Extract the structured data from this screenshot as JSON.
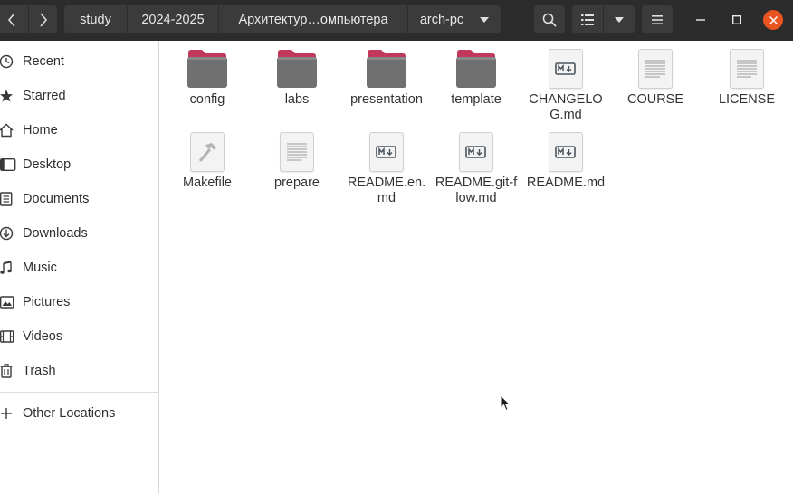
{
  "header": {
    "breadcrumbs": [
      "study",
      "2024-2025",
      "Архитектур…омпьютера",
      "arch-pc"
    ],
    "icons": {
      "back": "chevron-left-icon",
      "forward": "chevron-right-icon",
      "search": "search-icon",
      "view": "list-view-icon",
      "view_menu": "chevron-down-icon",
      "menu": "hamburger-menu-icon",
      "minimize": "minimize-icon",
      "maximize": "maximize-icon",
      "close": "close-icon"
    },
    "close_color": "#e95420"
  },
  "sidebar": {
    "items": [
      {
        "label": "Recent",
        "icon": "clock-icon"
      },
      {
        "label": "Starred",
        "icon": "star-icon"
      },
      {
        "label": "Home",
        "icon": "home-icon"
      },
      {
        "label": "Desktop",
        "icon": "desktop-icon"
      },
      {
        "label": "Documents",
        "icon": "documents-icon"
      },
      {
        "label": "Downloads",
        "icon": "download-icon"
      },
      {
        "label": "Music",
        "icon": "music-icon"
      },
      {
        "label": "Pictures",
        "icon": "pictures-icon"
      },
      {
        "label": "Videos",
        "icon": "videos-icon"
      },
      {
        "label": "Trash",
        "icon": "trash-icon"
      }
    ],
    "other_locations": {
      "label": "Other Locations",
      "icon": "plus-icon"
    }
  },
  "files": [
    {
      "name": "config",
      "type": "folder"
    },
    {
      "name": "labs",
      "type": "folder"
    },
    {
      "name": "presentation",
      "type": "folder"
    },
    {
      "name": "template",
      "type": "folder"
    },
    {
      "name": "CHANGELOG.md",
      "type": "markdown"
    },
    {
      "name": "COURSE",
      "type": "text"
    },
    {
      "name": "LICENSE",
      "type": "text"
    },
    {
      "name": "Makefile",
      "type": "makefile"
    },
    {
      "name": "prepare",
      "type": "text"
    },
    {
      "name": "README.en.md",
      "type": "markdown"
    },
    {
      "name": "README.git-flow.md",
      "type": "markdown"
    },
    {
      "name": "README.md",
      "type": "markdown"
    }
  ],
  "colors": {
    "header_bg": "#2c2c2c",
    "button_bg": "#3b3b3b",
    "folder_tab": "#c0395a",
    "folder_body": "#707070"
  }
}
